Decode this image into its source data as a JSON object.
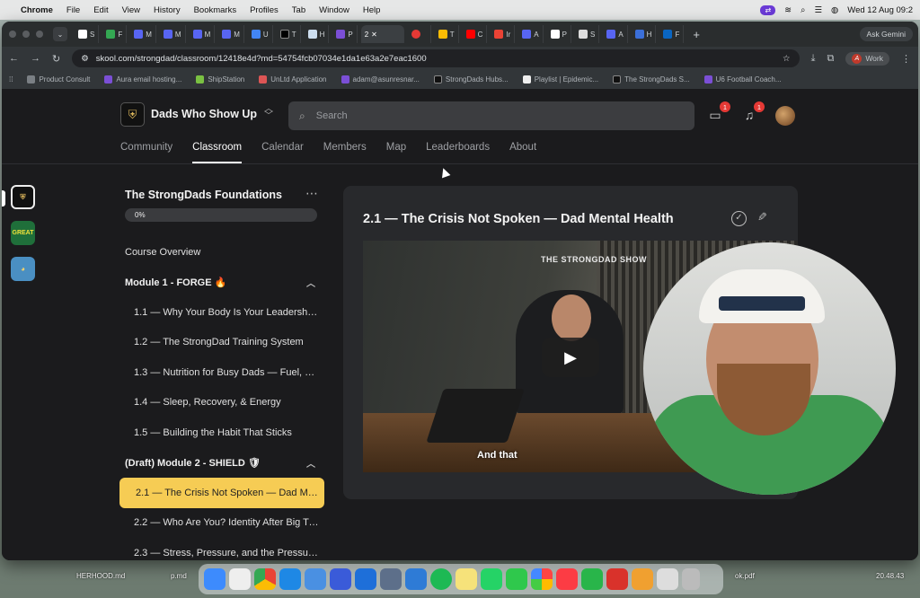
{
  "menubar": {
    "app": "Chrome",
    "items": [
      "File",
      "Edit",
      "View",
      "History",
      "Bookmarks",
      "Profiles",
      "Tab",
      "Window",
      "Help"
    ],
    "datetime": "Wed 12 Aug  09:2"
  },
  "browser": {
    "tabs": [
      "S",
      "F",
      "M",
      "M",
      "M",
      "M",
      "U",
      "T",
      "H",
      "P",
      "2",
      "",
      "T",
      "C",
      "Ir",
      "A",
      "P",
      "S",
      "A",
      "H",
      "F"
    ],
    "active_tab_index": 10,
    "ask_gemini": "Ask Gemini",
    "url": "skool.com/strongdad/classroom/12418e4d?md=54754fcb07034e1da1e63a2e7eac1600",
    "profile": "Work",
    "profile_initial": "A",
    "bookmarks": [
      "Product Consult",
      "Aura email hosting...",
      "ShipStation",
      "UnLtd Application",
      "adam@asunresnar...",
      "StrongDads Hubs...",
      "Playlist | Epidemic...",
      "The StrongDads S...",
      "U6 Football Coach..."
    ]
  },
  "header": {
    "group_name": "Dads Who Show Up",
    "search_placeholder": "Search",
    "chat_badge": "1",
    "notif_badge": "1"
  },
  "nav": {
    "tabs": [
      "Community",
      "Classroom",
      "Calendar",
      "Members",
      "Map",
      "Leaderboards",
      "About"
    ]
  },
  "rail": {
    "r2": "GREAT"
  },
  "course": {
    "title": "The StrongDads Foundations",
    "progress": 0,
    "progress_label": "0%",
    "items": [
      {
        "type": "lesson",
        "label": "Course Overview"
      },
      {
        "type": "module",
        "label": "Module 1 - FORGE 🔥"
      },
      {
        "type": "lesson",
        "label": "1.1 — Why Your Body Is Your Leadership..."
      },
      {
        "type": "lesson",
        "label": "1.2 — The StrongDad Training System"
      },
      {
        "type": "lesson",
        "label": "1.3 — Nutrition for Busy Dads — Fuel, N..."
      },
      {
        "type": "lesson",
        "label": "1.4 — Sleep, Recovery, & Energy"
      },
      {
        "type": "lesson",
        "label": "1.5 — Building the Habit That Sticks"
      },
      {
        "type": "module",
        "label": "(Draft) Module 2 - SHIELD 🛡"
      },
      {
        "type": "lesson",
        "label": "2.1 — The Crisis Not Spoken — Dad Men...",
        "selected": true
      },
      {
        "type": "lesson",
        "label": "2.2 — Who Are You? Identity After Big Tr..."
      },
      {
        "type": "lesson",
        "label": "2.3 — Stress, Pressure, and the Pressure..."
      }
    ]
  },
  "lesson": {
    "title": "2.1 — The Crisis Not Spoken — Dad Mental Health",
    "video_brand": "THE STRONGDAD SHOW",
    "subtitle": "And that"
  },
  "desktop": {
    "file_left": "HERHOOD.md",
    "file_left2": "p.md",
    "file_right": "ok.pdf",
    "clock": "20.48.43"
  }
}
